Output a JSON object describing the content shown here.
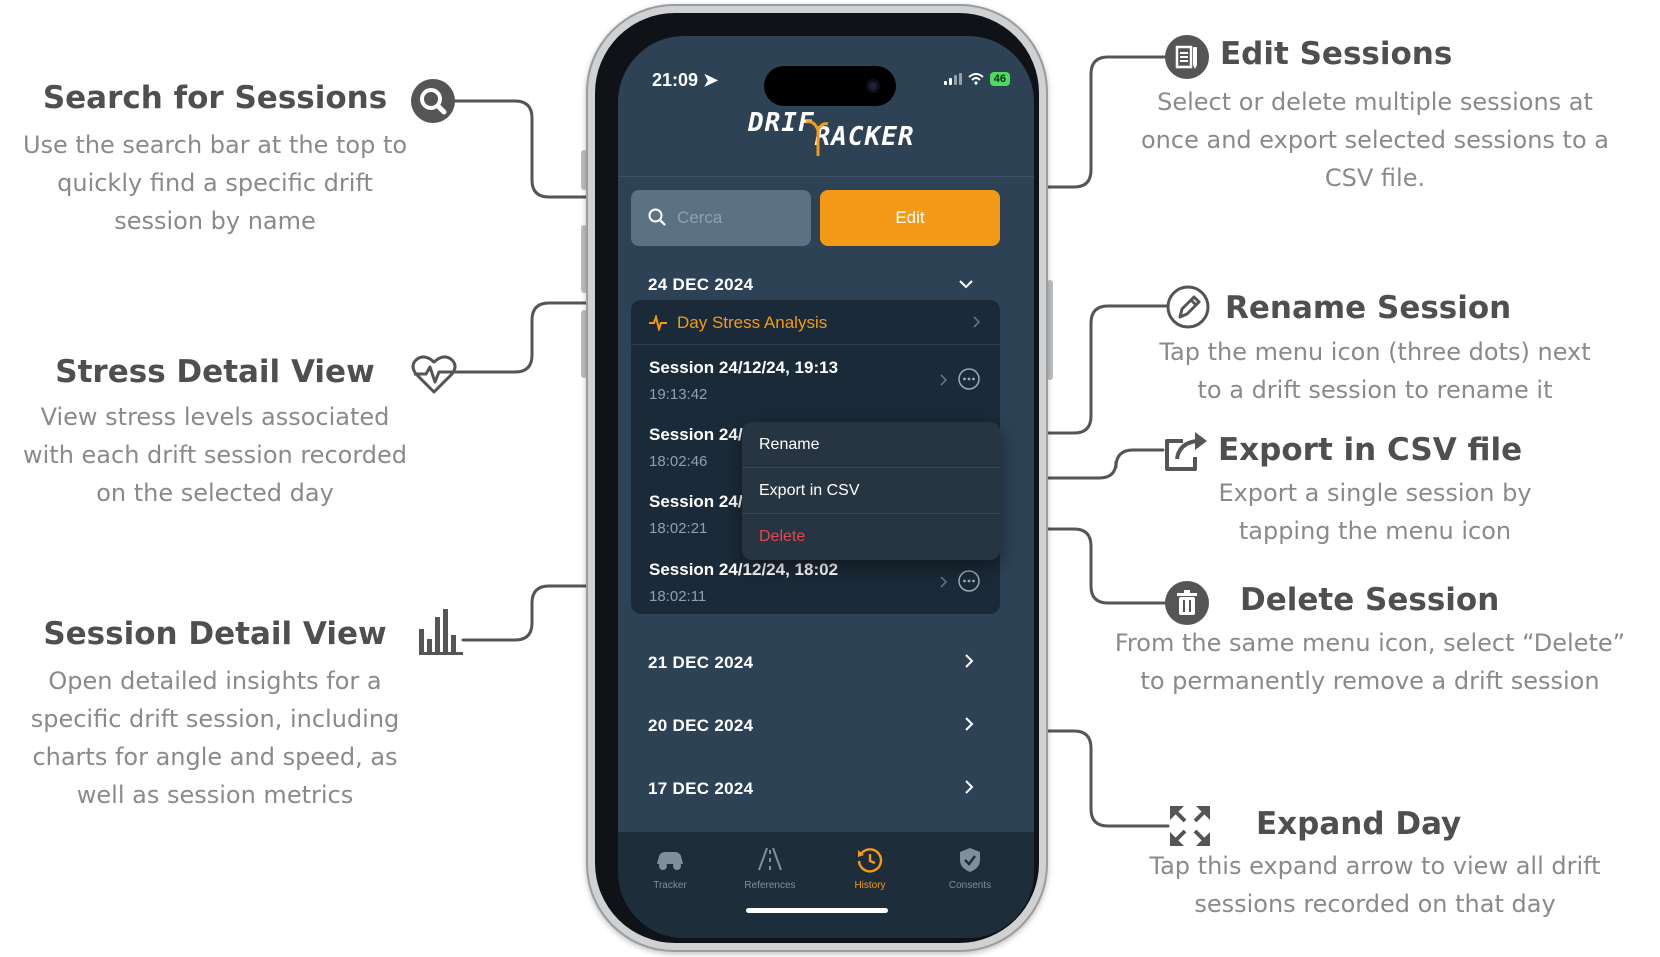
{
  "annotations": {
    "search": {
      "title": "Search for Sessions",
      "lines": [
        "Use the search bar at the top to",
        "quickly find a specific drift",
        "session by name"
      ],
      "icon": "search-icon"
    },
    "stress": {
      "title": "Stress Detail View",
      "lines": [
        "View stress levels associated",
        "with each drift session recorded",
        "on the selected day"
      ],
      "icon": "heart-pulse-icon"
    },
    "session_detail": {
      "title": "Session Detail View",
      "lines": [
        "Open detailed insights for a",
        "specific drift session, including",
        "charts for angle and speed, as",
        "well as session metrics"
      ],
      "icon": "bar-chart-icon"
    },
    "edit": {
      "title": "Edit Sessions",
      "lines": [
        "Select or delete multiple sessions at",
        "once and export selected sessions to a",
        "CSV file."
      ],
      "icon": "edit-list-icon"
    },
    "rename": {
      "title": "Rename Session",
      "lines": [
        "Tap the menu icon (three dots) next",
        "to a drift session to rename it"
      ],
      "icon": "pencil-icon"
    },
    "export": {
      "title": "Export in CSV file",
      "lines": [
        "Export a single session by",
        "tapping the menu icon"
      ],
      "icon": "share-icon"
    },
    "delete": {
      "title": "Delete Session",
      "lines": [
        "From the same menu icon, select “Delete”",
        "to permanently remove a drift session"
      ],
      "icon": "trash-icon"
    },
    "expand": {
      "title": "Expand Day",
      "lines": [
        "Tap this expand arrow to view all drift",
        "sessions recorded on that day"
      ],
      "icon": "expand-icon"
    }
  },
  "phone": {
    "status": {
      "time": "21:09",
      "battery": "46"
    },
    "logo": {
      "part1": "DRIF",
      "part2": "RACKER"
    },
    "search": {
      "placeholder": "Cerca"
    },
    "edit_label": "Edit",
    "expanded_day": {
      "date": "24 DEC 2024",
      "stress_label": "Day Stress Analysis",
      "sessions": [
        {
          "name": "Session 24/12/24, 19:13",
          "time": "19:13:42"
        },
        {
          "name": "Session 24/",
          "time": "18:02:46"
        },
        {
          "name": "Session 24/",
          "time": "18:02:21"
        },
        {
          "name": "Session 24/12/24, 18:02",
          "time": "18:02:11"
        }
      ]
    },
    "context_menu": {
      "rename": "Rename",
      "export": "Export in CSV",
      "delete": "Delete"
    },
    "collapsed_days": [
      "21 DEC 2024",
      "20 DEC 2024",
      "17 DEC 2024"
    ],
    "tabs": [
      {
        "label": "Tracker",
        "icon": "car-icon"
      },
      {
        "label": "References",
        "icon": "road-icon"
      },
      {
        "label": "History",
        "icon": "history-icon",
        "active": true
      },
      {
        "label": "Consents",
        "icon": "shield-check-icon"
      }
    ]
  },
  "colors": {
    "accent": "#f49a16",
    "screen_bg": "#2d4255",
    "card_bg": "#1b2a38",
    "delete": "#e5484d",
    "annotation_title": "#4f4f4f",
    "annotation_text": "#8a8a8a"
  }
}
